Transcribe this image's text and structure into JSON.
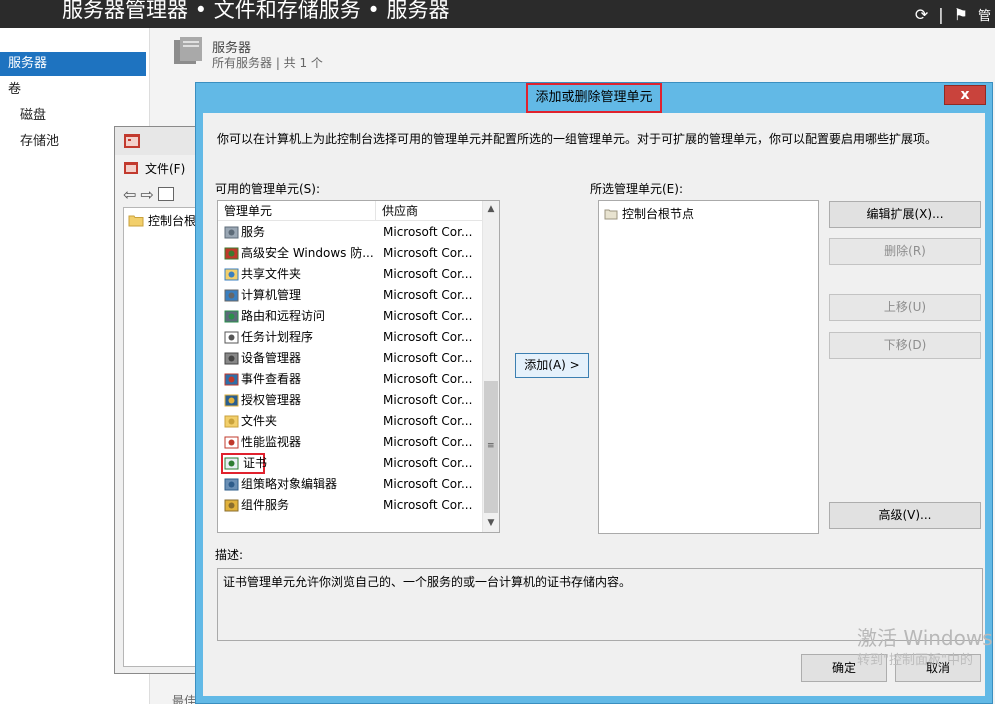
{
  "server_manager": {
    "breadcrumb": "服务器管理器 • 文件和存储服务 • 服务器",
    "right_icons": [
      "refresh-icon",
      "notifications-icon"
    ],
    "right_text": "管",
    "nav": {
      "items": [
        {
          "label": "服务器",
          "active": true
        },
        {
          "label": "卷",
          "active": false
        },
        {
          "label": "磁盘",
          "active": false
        },
        {
          "label": "存储池",
          "active": false
        }
      ]
    },
    "section_title": "服务器",
    "section_subtitle": "所有服务器 | 共 1 个",
    "bottom_label": "最佳"
  },
  "mmc": {
    "menu_file": "文件(F)",
    "tree_root": "控制台根"
  },
  "dialog": {
    "title": "添加或删除管理单元",
    "close_label": "x",
    "intro": "你可以在计算机上为此控制台选择可用的管理单元并配置所选的一组管理单元。对于可扩展的管理单元，你可以配置要启用哪些扩展项。",
    "available_label": "可用的管理单元(S):",
    "selected_label": "所选管理单元(E):",
    "columns": {
      "name": "管理单元",
      "vendor": "供应商"
    },
    "snapins": [
      {
        "name": "服务",
        "vendor": "Microsoft Cor...",
        "icon": "gears-icon"
      },
      {
        "name": "高级安全 Windows 防...",
        "vendor": "Microsoft Cor...",
        "icon": "firewall-icon"
      },
      {
        "name": "共享文件夹",
        "vendor": "Microsoft Cor...",
        "icon": "shared-folder-icon"
      },
      {
        "name": "计算机管理",
        "vendor": "Microsoft Cor...",
        "icon": "computer-management-icon"
      },
      {
        "name": "路由和远程访问",
        "vendor": "Microsoft Cor...",
        "icon": "routing-icon"
      },
      {
        "name": "任务计划程序",
        "vendor": "Microsoft Cor...",
        "icon": "clock-icon"
      },
      {
        "name": "设备管理器",
        "vendor": "Microsoft Cor...",
        "icon": "device-manager-icon"
      },
      {
        "name": "事件查看器",
        "vendor": "Microsoft Cor...",
        "icon": "event-viewer-icon"
      },
      {
        "name": "授权管理器",
        "vendor": "Microsoft Cor...",
        "icon": "authorization-icon"
      },
      {
        "name": "文件夹",
        "vendor": "Microsoft Cor...",
        "icon": "folder-icon"
      },
      {
        "name": "性能监视器",
        "vendor": "Microsoft Cor...",
        "icon": "performance-icon"
      },
      {
        "name": "证书",
        "vendor": "Microsoft Cor...",
        "icon": "certificate-icon"
      },
      {
        "name": "组策略对象编辑器",
        "vendor": "Microsoft Cor...",
        "icon": "group-policy-icon"
      },
      {
        "name": "组件服务",
        "vendor": "Microsoft Cor...",
        "icon": "component-services-icon"
      }
    ],
    "highlighted_index": 11,
    "scroll_grip": "≡",
    "add_button": "添加(A) >",
    "selected_items": [
      "控制台根节点"
    ],
    "buttons": {
      "edit": "编辑扩展(X)...",
      "delete": "删除(R)",
      "up": "上移(U)",
      "down": "下移(D)",
      "advanced": "高级(V)..."
    },
    "description_label": "描述:",
    "description": "证书管理单元允许你浏览自己的、一个服务的或一台计算机的证书存储内容。",
    "ok": "确定",
    "cancel": "取消"
  },
  "activation": {
    "line1": "激活 Windows",
    "line2": "转到\"控制面板\"中的"
  },
  "colors": {
    "dialog_border": "#62b9e6",
    "highlight_red": "#e0222e",
    "nav_active": "#1e73c0"
  }
}
